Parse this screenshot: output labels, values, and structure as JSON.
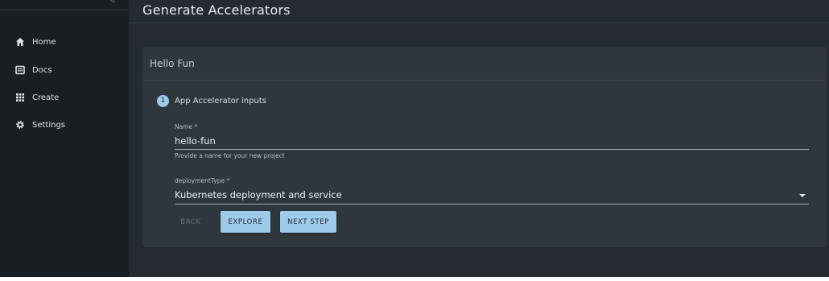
{
  "sidebar": {
    "items": [
      {
        "label": "Home",
        "icon": "home-icon"
      },
      {
        "label": "Docs",
        "icon": "docs-icon"
      },
      {
        "label": "Create",
        "icon": "create-grid-icon"
      },
      {
        "label": "Settings",
        "icon": "settings-gear-icon"
      }
    ]
  },
  "page": {
    "title": "Generate Accelerators"
  },
  "card": {
    "title": "Hello Fun"
  },
  "stepper": {
    "step_number": "1",
    "step_label": "App Accelerator inputs"
  },
  "form": {
    "name": {
      "label": "Name *",
      "value": "hello-fun",
      "helper": "Provide a name for your new project"
    },
    "deployment": {
      "label": "deploymentType *",
      "value": "Kubernetes deployment and service"
    }
  },
  "buttons": {
    "back": "BACK",
    "explore": "EXPLORE",
    "next": "NEXT STEP"
  },
  "colors": {
    "sidebar_bg": "#1b1e21",
    "main_bg": "#252b31",
    "card_bg": "#2e363e",
    "accent": "#9fcbea"
  }
}
